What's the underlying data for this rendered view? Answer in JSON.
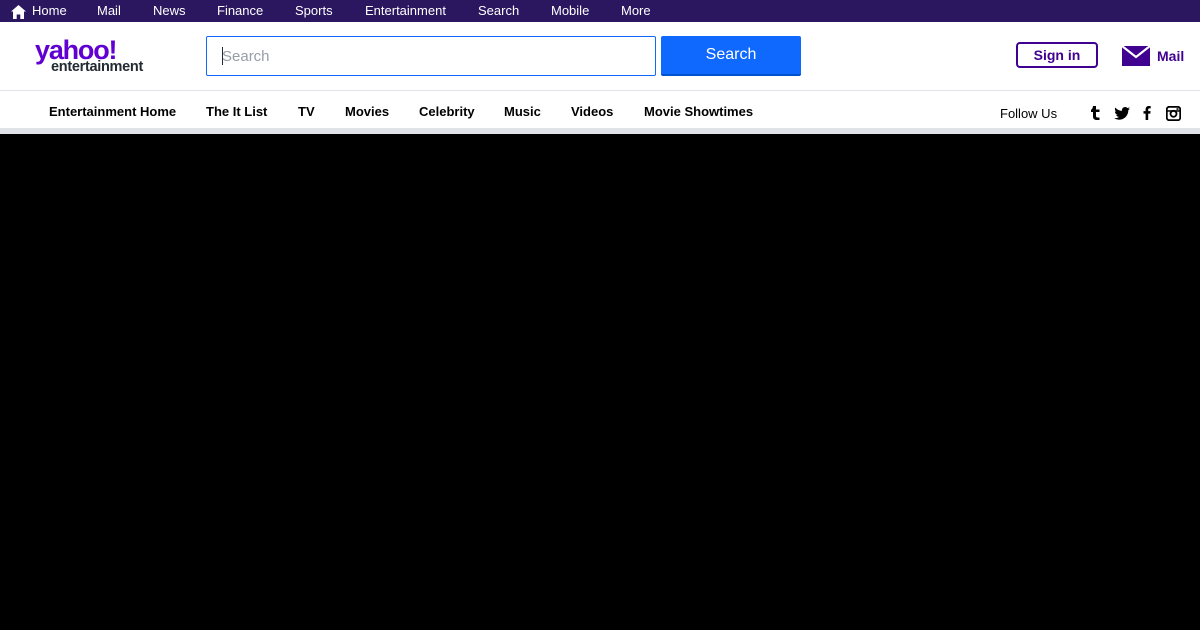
{
  "topbar": {
    "background": "#2b1660",
    "items": [
      {
        "label": "Home",
        "icon": "home-icon"
      },
      {
        "label": "Mail"
      },
      {
        "label": "News"
      },
      {
        "label": "Finance"
      },
      {
        "label": "Sports"
      },
      {
        "label": "Entertainment"
      },
      {
        "label": "Search"
      },
      {
        "label": "Mobile"
      },
      {
        "label": "More"
      }
    ]
  },
  "header": {
    "logo": {
      "brand": "yahoo!",
      "section": "entertainment"
    },
    "search": {
      "placeholder": "Search",
      "value": "",
      "button_label": "Search"
    },
    "signin_label": "Sign in",
    "mail_label": "Mail",
    "colors": {
      "brand_purple": "#6001d2",
      "accent_blue": "#0f69ff",
      "dark_purple": "#400090"
    }
  },
  "subnav": {
    "items": [
      {
        "label": "Entertainment Home"
      },
      {
        "label": "The It List"
      },
      {
        "label": "TV"
      },
      {
        "label": "Movies"
      },
      {
        "label": "Celebrity"
      },
      {
        "label": "Music"
      },
      {
        "label": "Videos"
      },
      {
        "label": "Movie Showtimes"
      }
    ],
    "follow_label": "Follow Us",
    "social": [
      "tumblr-icon",
      "twitter-icon",
      "facebook-icon",
      "instagram-icon"
    ]
  }
}
